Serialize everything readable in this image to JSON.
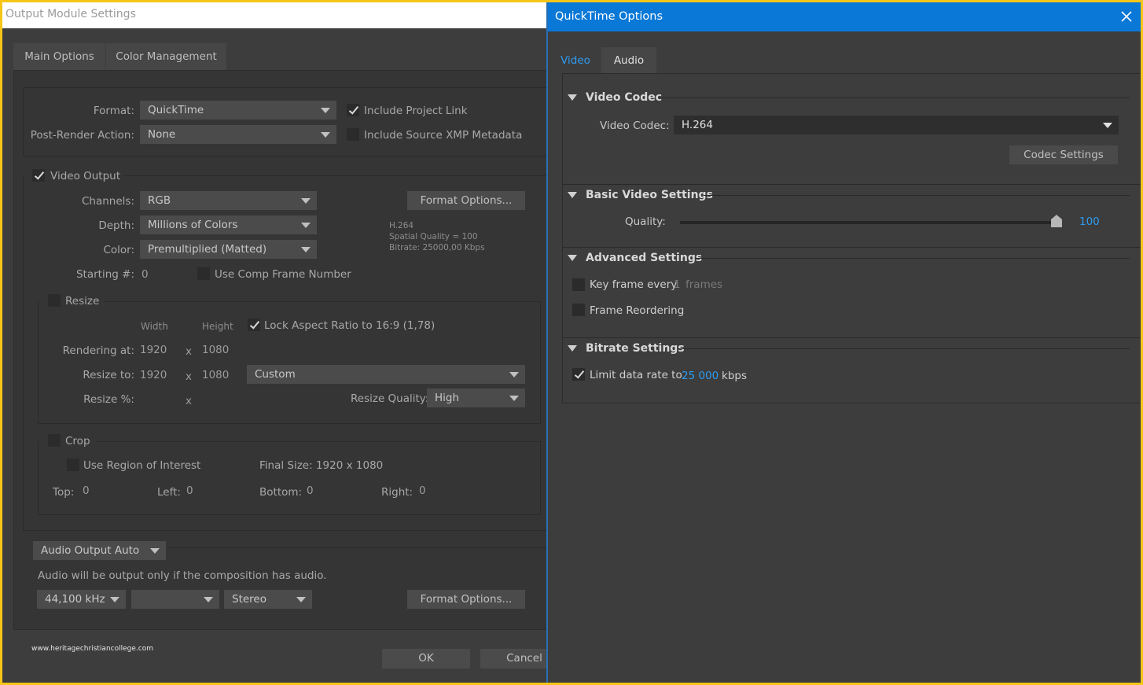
{
  "output_module": {
    "title": "Output Module Settings",
    "tabs": [
      "Main Options",
      "Color Management"
    ],
    "format_label": "Format:",
    "format_value": "QuickTime",
    "post_render_label": "Post-Render Action:",
    "post_render_value": "None",
    "include_project_link": "Include Project Link",
    "include_xmp": "Include Source XMP Metadata",
    "video_output": "Video Output",
    "channels_label": "Channels:",
    "channels_value": "RGB",
    "depth_label": "Depth:",
    "depth_value": "Millions of Colors",
    "color_label": "Color:",
    "color_value": "Premultiplied (Matted)",
    "starting_label": "Starting #:",
    "starting_value": "0",
    "use_comp_frame": "Use Comp Frame Number",
    "format_options": "Format Options...",
    "codec_info": [
      "H.264",
      "Spatial Quality = 100",
      "Bitrate: 25000,00 Kbps"
    ],
    "resize": "Resize",
    "width_header": "Width",
    "height_header": "Height",
    "lock_aspect": "Lock Aspect Ratio to 16:9 (1,78)",
    "rendering_at_label": "Rendering at:",
    "rendering_w": "1920",
    "rendering_h": "1080",
    "resize_to_label": "Resize to:",
    "resize_w": "1920",
    "resize_h": "1080",
    "x_sep": "x",
    "resize_preset": "Custom",
    "resize_pct_label": "Resize %:",
    "resize_quality_label": "Resize Quality:",
    "resize_quality_value": "High",
    "crop": "Crop",
    "use_roi": "Use Region of Interest",
    "final_size": "Final Size: 1920 x 1080",
    "top_label": "Top:",
    "top_value": "0",
    "left_label": "Left:",
    "left_value": "0",
    "bottom_label": "Bottom:",
    "bottom_value": "0",
    "right_label": "Right:",
    "right_value": "0",
    "audio_output": "Audio Output Auto",
    "audio_note": "Audio will be output only if the composition has audio.",
    "sample_rate": "44,100 kHz",
    "channels_audio": "Stereo",
    "audio_format_options": "Format Options...",
    "watermark": "www.heritagechristiancollege.com",
    "ok": "OK",
    "cancel": "Cancel"
  },
  "quicktime": {
    "title": "QuickTime Options",
    "tabs": [
      "Video",
      "Audio"
    ],
    "video_codec_section": "Video Codec",
    "video_codec_label": "Video Codec:",
    "video_codec_value": "H.264",
    "codec_settings": "Codec Settings",
    "basic_section": "Basic Video Settings",
    "quality_label": "Quality:",
    "quality_value": "100",
    "quality_fraction": 1.0,
    "advanced_section": "Advanced Settings",
    "key_frame_label": "Key frame every",
    "key_frame_value": "1",
    "key_frame_unit": "frames",
    "frame_reordering": "Frame Reordering",
    "bitrate_section": "Bitrate Settings",
    "limit_rate_label": "Limit data rate to",
    "limit_rate_value": "25 000",
    "limit_rate_unit": "kbps"
  },
  "colors": {
    "accent": "#0a78d7",
    "link_blue": "#2d9bf0",
    "frame": "#f5c518"
  }
}
